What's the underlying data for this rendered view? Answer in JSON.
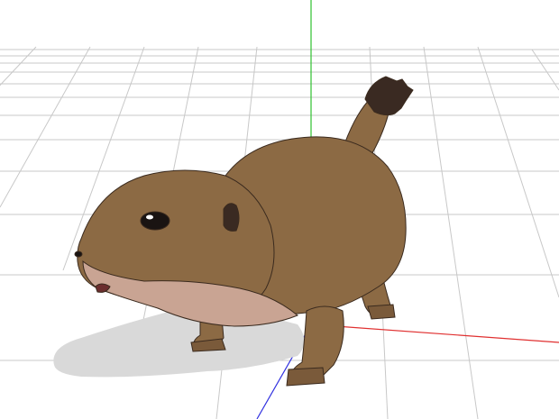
{
  "viewport": {
    "background": "#ffffff",
    "grid_color": "#c8c8c8",
    "axis_colors": {
      "x": "#e03030",
      "y": "#30c030",
      "z": "#3030e0"
    }
  },
  "model": {
    "icon": "prairie-dog-model",
    "fur_color": "#8c6a44",
    "belly_color": "#c9a493",
    "tail_tip_color": "#3a2a22"
  }
}
